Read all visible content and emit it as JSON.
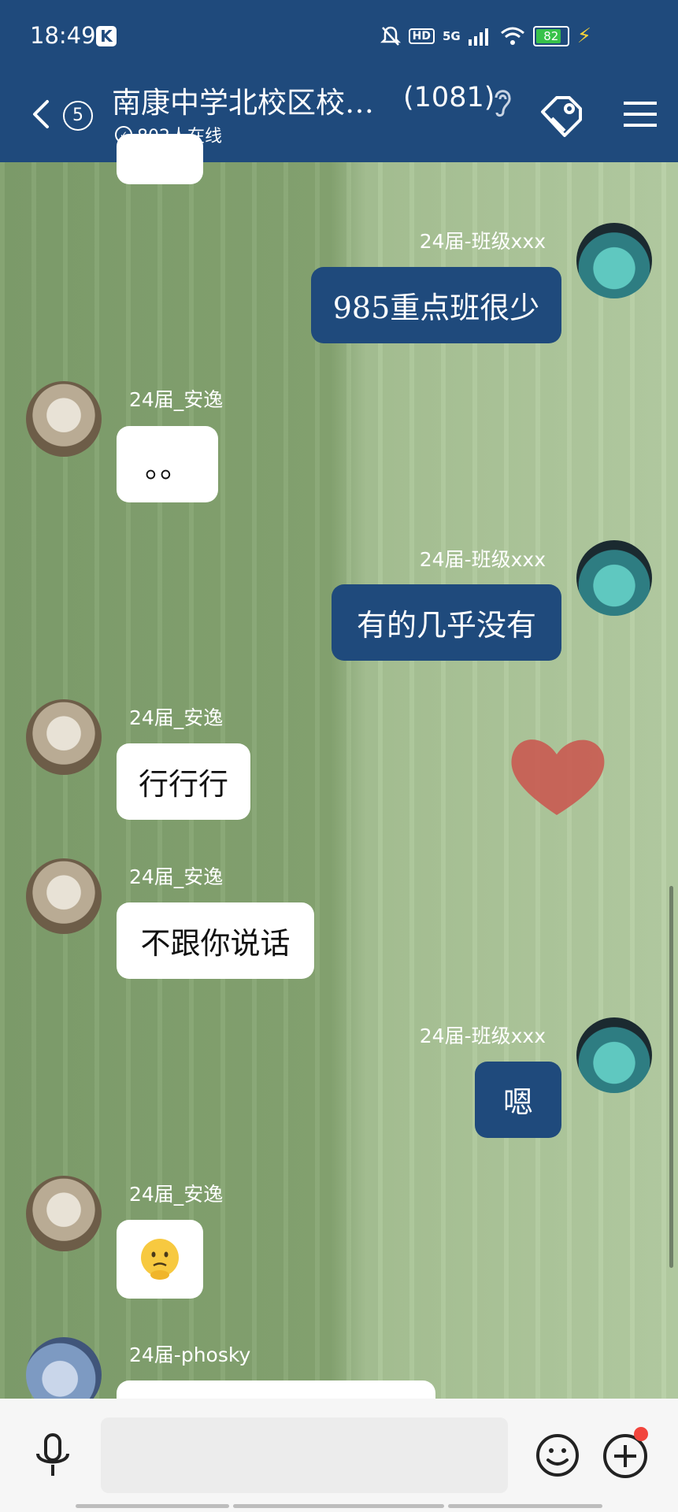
{
  "status_bar": {
    "time": "18:49",
    "app_badge": "K",
    "hd_label": "HD",
    "network_label": "5G",
    "battery_level": "82",
    "battery_percent": 82
  },
  "header": {
    "unread_count": "5",
    "group_name": "南康中学北校区校…",
    "member_count": "(1081)",
    "online_text": "802人在线"
  },
  "messages": [
    {
      "side": "right",
      "sender": "24届-班级xxx",
      "text": "985重点班很少"
    },
    {
      "side": "left",
      "sender": "24届_安逸",
      "text": "。。"
    },
    {
      "side": "right",
      "sender": "24届-班级xxx",
      "text": "有的几乎没有"
    },
    {
      "side": "left",
      "sender": "24届_安逸",
      "text": "行行行"
    },
    {
      "side": "left",
      "sender": "24届_安逸",
      "text": "不跟你说话"
    },
    {
      "side": "right",
      "sender": "24届-班级xxx",
      "text": "嗯"
    },
    {
      "side": "left",
      "sender": "24届_安逸",
      "text": "😯",
      "sticker": "confused-emoji"
    },
    {
      "side": "left",
      "sender": "24届-phosky",
      "text": ""
    }
  ],
  "input": {
    "placeholder": ""
  },
  "colors": {
    "header": "#1f4a7c",
    "my_bubble": "#1f4a7c",
    "other_bubble": "#ffffff",
    "badge": "#f2453d"
  },
  "icons": [
    "back-arrow-icon",
    "ear-icon",
    "tag-icon",
    "menu-icon",
    "mic-icon",
    "emoji-icon",
    "plus-icon"
  ]
}
